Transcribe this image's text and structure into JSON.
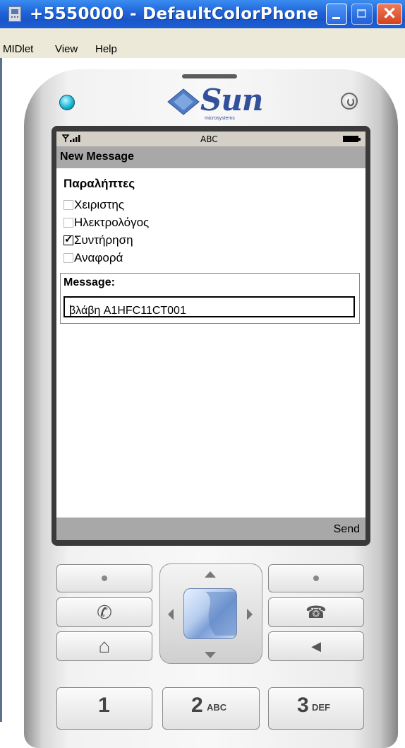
{
  "window": {
    "title": "+5550000 - DefaultColorPhone",
    "close_glyph": "✕",
    "controls": [
      "minimize",
      "maximize",
      "close"
    ]
  },
  "menubar": {
    "items": [
      {
        "label": "MIDlet"
      },
      {
        "label": "View"
      },
      {
        "label": "Help"
      }
    ]
  },
  "phone": {
    "brand": "Sun",
    "brand_sub": "microsystems",
    "status": {
      "input_mode": "ABC",
      "signal_icon": "signal-strength-icon",
      "battery_icon": "battery-icon"
    },
    "screen": {
      "title": "New Message",
      "recipients_label": "Παραλήπτες",
      "recipients": [
        {
          "label": "Χειριστης",
          "checked": false
        },
        {
          "label": "Ηλεκτρολόγος",
          "checked": false
        },
        {
          "label": "Συντήρηση",
          "checked": true
        },
        {
          "label": "Αναφορά",
          "checked": false
        }
      ],
      "message_label": "Message:",
      "message_value": "βλάβη A1HFC11CT001",
      "softkey_right": "Send"
    },
    "keys": {
      "call_glyph": "✆",
      "end_glyph": "☎",
      "home_glyph": "⌂",
      "clear_glyph": "◀",
      "digits": [
        {
          "digit": "1",
          "letters": ""
        },
        {
          "digit": "2",
          "letters": "ABC"
        },
        {
          "digit": "3",
          "letters": "DEF"
        }
      ]
    }
  }
}
